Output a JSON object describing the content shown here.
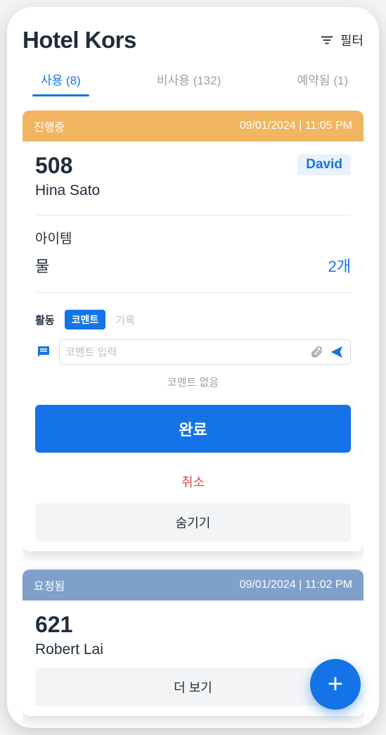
{
  "header": {
    "title": "Hotel Kors",
    "filter_label": "필터"
  },
  "tabs": [
    {
      "label": "사용 (8)",
      "active": true
    },
    {
      "label": "비사용 (132)",
      "active": false
    },
    {
      "label": "예약됨 (1)",
      "active": false
    }
  ],
  "cards": [
    {
      "status_label": "진행중",
      "status_color": "orange",
      "timestamp": "09/01/2024 | 11:05 PM",
      "room_number": "508",
      "guest_name": "Hina Sato",
      "assignee": "David",
      "items_heading": "아이템",
      "items": [
        {
          "name": "물",
          "qty": "2개"
        }
      ],
      "activity": {
        "heading": "활동",
        "active_tab": "코멘트",
        "inactive_tab": "기록",
        "comment_placeholder": "코멘트 입력",
        "empty_text": "코멘트 없음"
      },
      "buttons": {
        "primary": "완료",
        "cancel": "취소",
        "hide": "숨기기"
      }
    },
    {
      "status_label": "요청됨",
      "status_color": "blue",
      "timestamp": "09/01/2024 | 11:02 PM",
      "room_number": "621",
      "guest_name": "Robert Lai",
      "more_button": "더 보기"
    }
  ],
  "fab_label": "+"
}
